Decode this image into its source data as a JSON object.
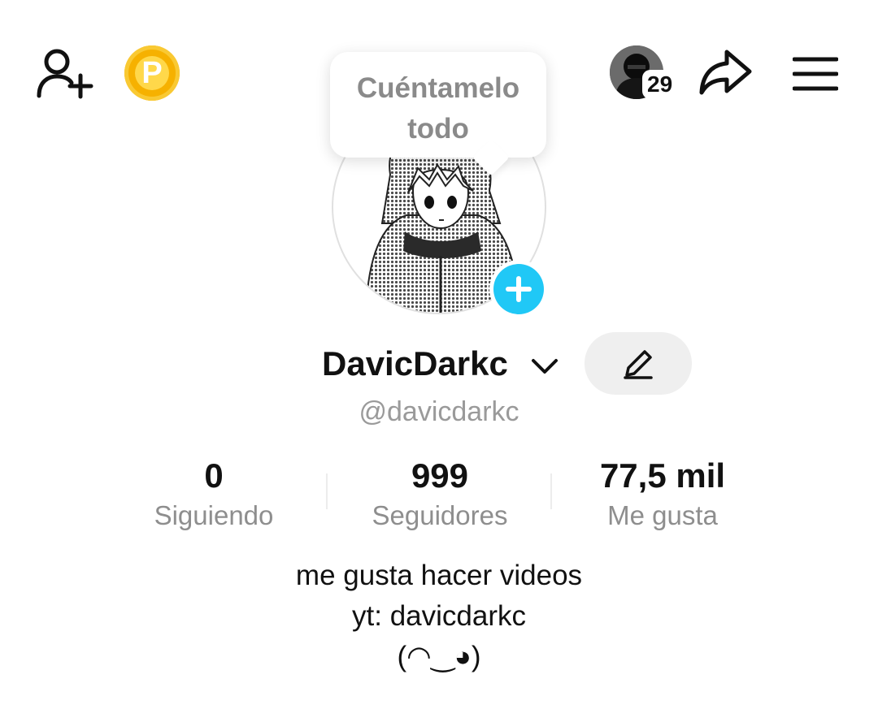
{
  "top_bar": {
    "coin_letter": "P",
    "notification_count": "29"
  },
  "tooltip": {
    "text": "Cuéntamelo todo"
  },
  "profile": {
    "display_name": "DavicDarkc",
    "handle": "@davicdarkc"
  },
  "stats": [
    {
      "value": "0",
      "label": "Siguiendo"
    },
    {
      "value": "999",
      "label": "Seguidores"
    },
    {
      "value": "77,5 mil",
      "label": "Me gusta"
    }
  ],
  "bio": {
    "line1": "me gusta hacer videos",
    "line2": "yt: davicdarkc",
    "line3": "(◠‿◕)"
  },
  "icons": {
    "add_user": "add-friend-icon",
    "coin": "coin-icon",
    "share": "share-icon",
    "menu": "hamburger-menu-icon",
    "edit": "pencil-icon",
    "chevron": "chevron-down-icon",
    "plus": "plus-icon"
  },
  "colors": {
    "accent_blue": "#20c8f6",
    "coin_gold": "#f6b100",
    "text_primary": "#111111",
    "text_secondary": "#8e8e8e"
  }
}
